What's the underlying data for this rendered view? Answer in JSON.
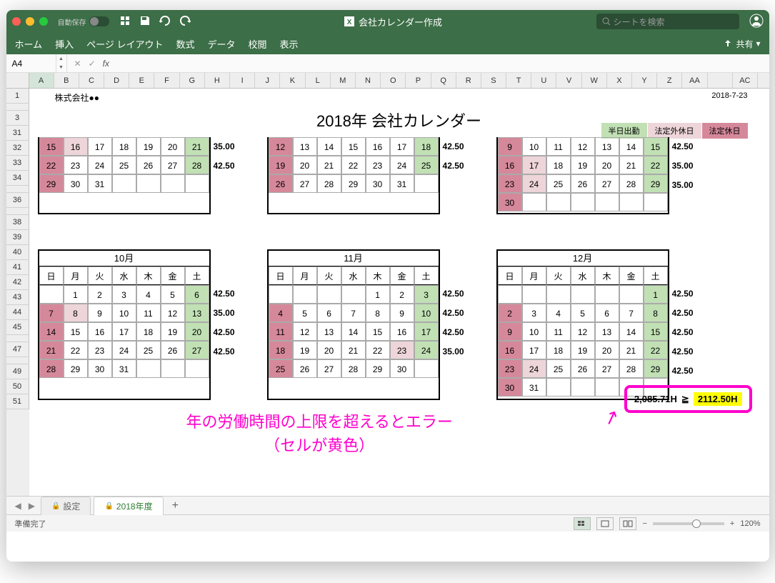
{
  "titlebar": {
    "autosave_label": "自動保存",
    "document_title": "会社カレンダー作成",
    "search_placeholder": "シートを検索"
  },
  "ribbon": {
    "home": "ホーム",
    "insert": "挿入",
    "page_layout": "ページ レイアウト",
    "formulas": "数式",
    "data": "データ",
    "review": "校閲",
    "view": "表示",
    "share": "共有"
  },
  "namebox": {
    "cell": "A4",
    "fx": "fx"
  },
  "columns": [
    "A",
    "B",
    "C",
    "D",
    "E",
    "F",
    "G",
    "H",
    "I",
    "J",
    "K",
    "L",
    "M",
    "N",
    "O",
    "P",
    "Q",
    "R",
    "S",
    "T",
    "U",
    "V",
    "W",
    "X",
    "Y",
    "Z",
    "AA",
    "",
    "AC"
  ],
  "rows": [
    "1",
    "",
    "3",
    "31",
    "32",
    "33",
    "34",
    "",
    "36",
    "",
    "38",
    "39",
    "40",
    "41",
    "42",
    "43",
    "44",
    "45",
    "",
    "47",
    "",
    "49",
    "50",
    "51"
  ],
  "sheet": {
    "company": "株式会社●●",
    "date": "2018-7-23",
    "title": "2018年 会社カレンダー",
    "legend": {
      "half": "半日出勤",
      "nonlegal": "法定外休日",
      "legal": "法定休日"
    }
  },
  "day_headers": [
    "日",
    "月",
    "火",
    "水",
    "木",
    "金",
    "土"
  ],
  "cal_partial_1": {
    "weeks": [
      [
        {
          "v": "15",
          "c": "dr"
        },
        {
          "v": "16",
          "c": "lr"
        },
        {
          "v": "17"
        },
        {
          "v": "18"
        },
        {
          "v": "19"
        },
        {
          "v": "20"
        },
        {
          "v": "21",
          "c": "g"
        }
      ],
      [
        {
          "v": "22",
          "c": "dr"
        },
        {
          "v": "23"
        },
        {
          "v": "24"
        },
        {
          "v": "25"
        },
        {
          "v": "26"
        },
        {
          "v": "27"
        },
        {
          "v": "28",
          "c": "g"
        }
      ],
      [
        {
          "v": "29",
          "c": "dr"
        },
        {
          "v": "30"
        },
        {
          "v": "31"
        },
        {
          "v": ""
        },
        {
          "v": ""
        },
        {
          "v": ""
        },
        {
          "v": ""
        }
      ]
    ],
    "hours": [
      "35.00",
      "42.50",
      ""
    ]
  },
  "cal_partial_2": {
    "weeks": [
      [
        {
          "v": "12",
          "c": "dr"
        },
        {
          "v": "13"
        },
        {
          "v": "14"
        },
        {
          "v": "15"
        },
        {
          "v": "16"
        },
        {
          "v": "17"
        },
        {
          "v": "18",
          "c": "g"
        }
      ],
      [
        {
          "v": "19",
          "c": "dr"
        },
        {
          "v": "20"
        },
        {
          "v": "21"
        },
        {
          "v": "22"
        },
        {
          "v": "23"
        },
        {
          "v": "24"
        },
        {
          "v": "25",
          "c": "g"
        }
      ],
      [
        {
          "v": "26",
          "c": "dr"
        },
        {
          "v": "27"
        },
        {
          "v": "28"
        },
        {
          "v": "29"
        },
        {
          "v": "30"
        },
        {
          "v": "31"
        },
        {
          "v": ""
        }
      ]
    ],
    "hours": [
      "42.50",
      "42.50",
      ""
    ]
  },
  "cal_partial_3": {
    "weeks": [
      [
        {
          "v": "9",
          "c": "dr"
        },
        {
          "v": "10"
        },
        {
          "v": "11"
        },
        {
          "v": "12"
        },
        {
          "v": "13"
        },
        {
          "v": "14"
        },
        {
          "v": "15",
          "c": "g"
        }
      ],
      [
        {
          "v": "16",
          "c": "dr"
        },
        {
          "v": "17",
          "c": "lr"
        },
        {
          "v": "18"
        },
        {
          "v": "19"
        },
        {
          "v": "20"
        },
        {
          "v": "21"
        },
        {
          "v": "22",
          "c": "g"
        }
      ],
      [
        {
          "v": "23",
          "c": "dr"
        },
        {
          "v": "24",
          "c": "lr"
        },
        {
          "v": "25"
        },
        {
          "v": "26"
        },
        {
          "v": "27"
        },
        {
          "v": "28"
        },
        {
          "v": "29",
          "c": "g"
        }
      ],
      [
        {
          "v": "30",
          "c": "dr"
        },
        {
          "v": ""
        },
        {
          "v": ""
        },
        {
          "v": ""
        },
        {
          "v": ""
        },
        {
          "v": ""
        },
        {
          "v": ""
        }
      ]
    ],
    "hours": [
      "42.50",
      "35.00",
      "35.00",
      ""
    ]
  },
  "cal_oct": {
    "month": "10月",
    "weeks": [
      [
        {
          "v": ""
        },
        {
          "v": "1"
        },
        {
          "v": "2"
        },
        {
          "v": "3"
        },
        {
          "v": "4"
        },
        {
          "v": "5"
        },
        {
          "v": "6",
          "c": "g"
        }
      ],
      [
        {
          "v": "7",
          "c": "dr"
        },
        {
          "v": "8",
          "c": "lr"
        },
        {
          "v": "9"
        },
        {
          "v": "10"
        },
        {
          "v": "11"
        },
        {
          "v": "12"
        },
        {
          "v": "13",
          "c": "g"
        }
      ],
      [
        {
          "v": "14",
          "c": "dr"
        },
        {
          "v": "15"
        },
        {
          "v": "16"
        },
        {
          "v": "17"
        },
        {
          "v": "18"
        },
        {
          "v": "19"
        },
        {
          "v": "20",
          "c": "g"
        }
      ],
      [
        {
          "v": "21",
          "c": "dr"
        },
        {
          "v": "22"
        },
        {
          "v": "23"
        },
        {
          "v": "24"
        },
        {
          "v": "25"
        },
        {
          "v": "26"
        },
        {
          "v": "27",
          "c": "g"
        }
      ],
      [
        {
          "v": "28",
          "c": "dr"
        },
        {
          "v": "29"
        },
        {
          "v": "30"
        },
        {
          "v": "31"
        },
        {
          "v": ""
        },
        {
          "v": ""
        },
        {
          "v": ""
        }
      ]
    ],
    "hours": [
      "42.50",
      "35.00",
      "42.50",
      "42.50",
      ""
    ]
  },
  "cal_nov": {
    "month": "11月",
    "weeks": [
      [
        {
          "v": ""
        },
        {
          "v": ""
        },
        {
          "v": ""
        },
        {
          "v": ""
        },
        {
          "v": "1"
        },
        {
          "v": "2"
        },
        {
          "v": "3",
          "c": "g"
        }
      ],
      [
        {
          "v": "4",
          "c": "dr"
        },
        {
          "v": "5"
        },
        {
          "v": "6"
        },
        {
          "v": "7"
        },
        {
          "v": "8"
        },
        {
          "v": "9"
        },
        {
          "v": "10",
          "c": "g"
        }
      ],
      [
        {
          "v": "11",
          "c": "dr"
        },
        {
          "v": "12"
        },
        {
          "v": "13"
        },
        {
          "v": "14"
        },
        {
          "v": "15"
        },
        {
          "v": "16"
        },
        {
          "v": "17",
          "c": "g"
        }
      ],
      [
        {
          "v": "18",
          "c": "dr"
        },
        {
          "v": "19"
        },
        {
          "v": "20"
        },
        {
          "v": "21"
        },
        {
          "v": "22"
        },
        {
          "v": "23",
          "c": "lr"
        },
        {
          "v": "24",
          "c": "g"
        }
      ],
      [
        {
          "v": "25",
          "c": "dr"
        },
        {
          "v": "26"
        },
        {
          "v": "27"
        },
        {
          "v": "28"
        },
        {
          "v": "29"
        },
        {
          "v": "30"
        },
        {
          "v": ""
        }
      ]
    ],
    "hours": [
      "42.50",
      "42.50",
      "42.50",
      "35.00",
      ""
    ]
  },
  "cal_dec": {
    "month": "12月",
    "weeks": [
      [
        {
          "v": ""
        },
        {
          "v": ""
        },
        {
          "v": ""
        },
        {
          "v": ""
        },
        {
          "v": ""
        },
        {
          "v": ""
        },
        {
          "v": "1",
          "c": "g"
        }
      ],
      [
        {
          "v": "2",
          "c": "dr"
        },
        {
          "v": "3"
        },
        {
          "v": "4"
        },
        {
          "v": "5"
        },
        {
          "v": "6"
        },
        {
          "v": "7"
        },
        {
          "v": "8",
          "c": "g"
        }
      ],
      [
        {
          "v": "9",
          "c": "dr"
        },
        {
          "v": "10"
        },
        {
          "v": "11"
        },
        {
          "v": "12"
        },
        {
          "v": "13"
        },
        {
          "v": "14"
        },
        {
          "v": "15",
          "c": "g"
        }
      ],
      [
        {
          "v": "16",
          "c": "dr"
        },
        {
          "v": "17"
        },
        {
          "v": "18"
        },
        {
          "v": "19"
        },
        {
          "v": "20"
        },
        {
          "v": "21"
        },
        {
          "v": "22",
          "c": "g"
        }
      ],
      [
        {
          "v": "23",
          "c": "dr"
        },
        {
          "v": "24",
          "c": "lr"
        },
        {
          "v": "25"
        },
        {
          "v": "26"
        },
        {
          "v": "27"
        },
        {
          "v": "28"
        },
        {
          "v": "29",
          "c": "g"
        }
      ],
      [
        {
          "v": "30",
          "c": "dr"
        },
        {
          "v": "31"
        },
        {
          "v": ""
        },
        {
          "v": ""
        },
        {
          "v": ""
        },
        {
          "v": ""
        },
        {
          "v": ""
        }
      ]
    ],
    "hours": [
      "42.50",
      "42.50",
      "42.50",
      "42.50",
      "42.50",
      ""
    ]
  },
  "highlight": {
    "limit": "2,085.71H",
    "op": "≧",
    "actual": "2112.50H"
  },
  "annotation": {
    "line1": "年の労働時間の上限を超えるとエラー",
    "line2": "（セルが黄色）"
  },
  "tabs": {
    "settings": "設定",
    "fy2018": "2018年度"
  },
  "statusbar": {
    "ready": "準備完了",
    "zoom": "120%"
  }
}
